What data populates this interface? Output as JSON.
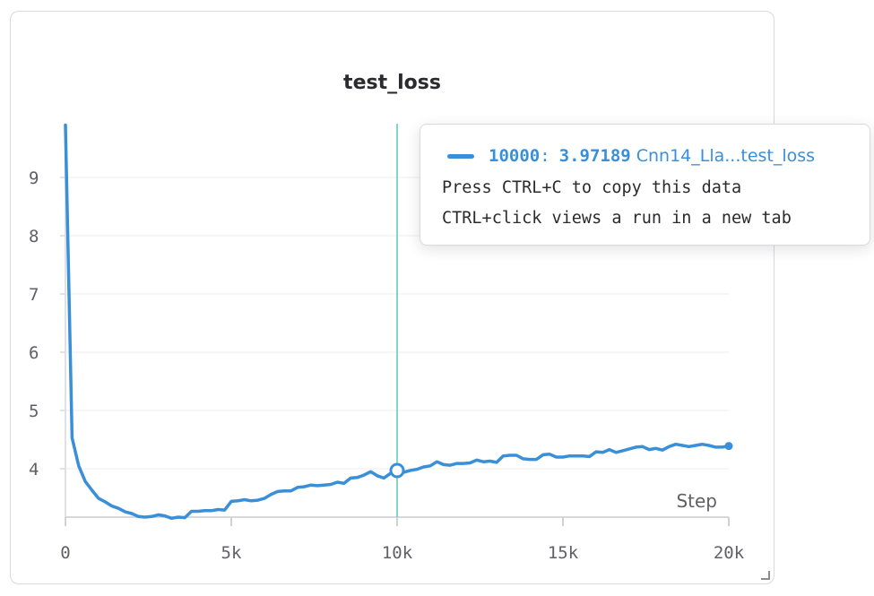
{
  "chart_data": {
    "type": "line",
    "title": "test_loss",
    "xlabel": "Step",
    "ylabel": "",
    "xlim": [
      0,
      20000
    ],
    "ylim": [
      3.15,
      10
    ],
    "x_ticks": [
      0,
      5000,
      10000,
      15000,
      20000
    ],
    "x_tick_labels": [
      "0",
      "5k",
      "10k",
      "15k",
      "20k"
    ],
    "y_ticks": [
      4,
      5,
      6,
      7,
      8,
      9
    ],
    "y_tick_labels": [
      "4",
      "5",
      "6",
      "7",
      "8",
      "9"
    ],
    "grid": true,
    "hover_step": 10000,
    "series": [
      {
        "name": "Cnn14_Lla...test_loss",
        "color": "#3a8fd9",
        "x": [
          0,
          200,
          400,
          600,
          800,
          1000,
          1200,
          1400,
          1600,
          1800,
          2000,
          2200,
          2400,
          2600,
          2800,
          3000,
          3200,
          3400,
          3600,
          3800,
          4000,
          4200,
          4400,
          4600,
          4800,
          5000,
          5200,
          5400,
          5600,
          5800,
          6000,
          6200,
          6400,
          6600,
          6800,
          7000,
          7200,
          7400,
          7600,
          7800,
          8000,
          8200,
          8400,
          8600,
          8800,
          9000,
          9200,
          9400,
          9600,
          9800,
          10000,
          10200,
          10400,
          10600,
          10800,
          11000,
          11200,
          11400,
          11600,
          11800,
          12000,
          12200,
          12400,
          12600,
          12800,
          13000,
          13200,
          13400,
          13600,
          13800,
          14000,
          14200,
          14400,
          14600,
          14800,
          15000,
          15200,
          15400,
          15600,
          15800,
          16000,
          16200,
          16400,
          16600,
          16800,
          17000,
          17200,
          17400,
          17600,
          17800,
          18000,
          18200,
          18400,
          18600,
          18800,
          19000,
          19200,
          19400,
          19600,
          19800,
          20000
        ],
        "values": [
          9.9,
          4.53,
          4.05,
          3.78,
          3.63,
          3.49,
          3.43,
          3.36,
          3.32,
          3.26,
          3.23,
          3.18,
          3.17,
          3.18,
          3.21,
          3.19,
          3.15,
          3.17,
          3.16,
          3.27,
          3.27,
          3.28,
          3.28,
          3.3,
          3.29,
          3.44,
          3.45,
          3.47,
          3.45,
          3.46,
          3.49,
          3.56,
          3.61,
          3.62,
          3.62,
          3.68,
          3.69,
          3.72,
          3.71,
          3.72,
          3.73,
          3.77,
          3.75,
          3.84,
          3.85,
          3.89,
          3.95,
          3.88,
          3.84,
          3.92,
          3.97,
          3.94,
          3.97,
          3.99,
          4.03,
          4.05,
          4.12,
          4.07,
          4.06,
          4.09,
          4.09,
          4.1,
          4.15,
          4.12,
          4.13,
          4.11,
          4.22,
          4.23,
          4.23,
          4.17,
          4.16,
          4.16,
          4.24,
          4.25,
          4.2,
          4.2,
          4.22,
          4.22,
          4.22,
          4.21,
          4.29,
          4.28,
          4.33,
          4.28,
          4.31,
          4.34,
          4.37,
          4.38,
          4.33,
          4.35,
          4.32,
          4.38,
          4.42,
          4.4,
          4.38,
          4.4,
          4.42,
          4.4,
          4.37,
          4.37,
          4.39
        ]
      }
    ]
  },
  "tooltip": {
    "step": "10000",
    "colon": ":",
    "value": "3.97189",
    "run": "Cnn14_Lla...test_loss",
    "line1": "Press CTRL+C to copy this data",
    "line2": "CTRL+click views a run in a new tab"
  }
}
